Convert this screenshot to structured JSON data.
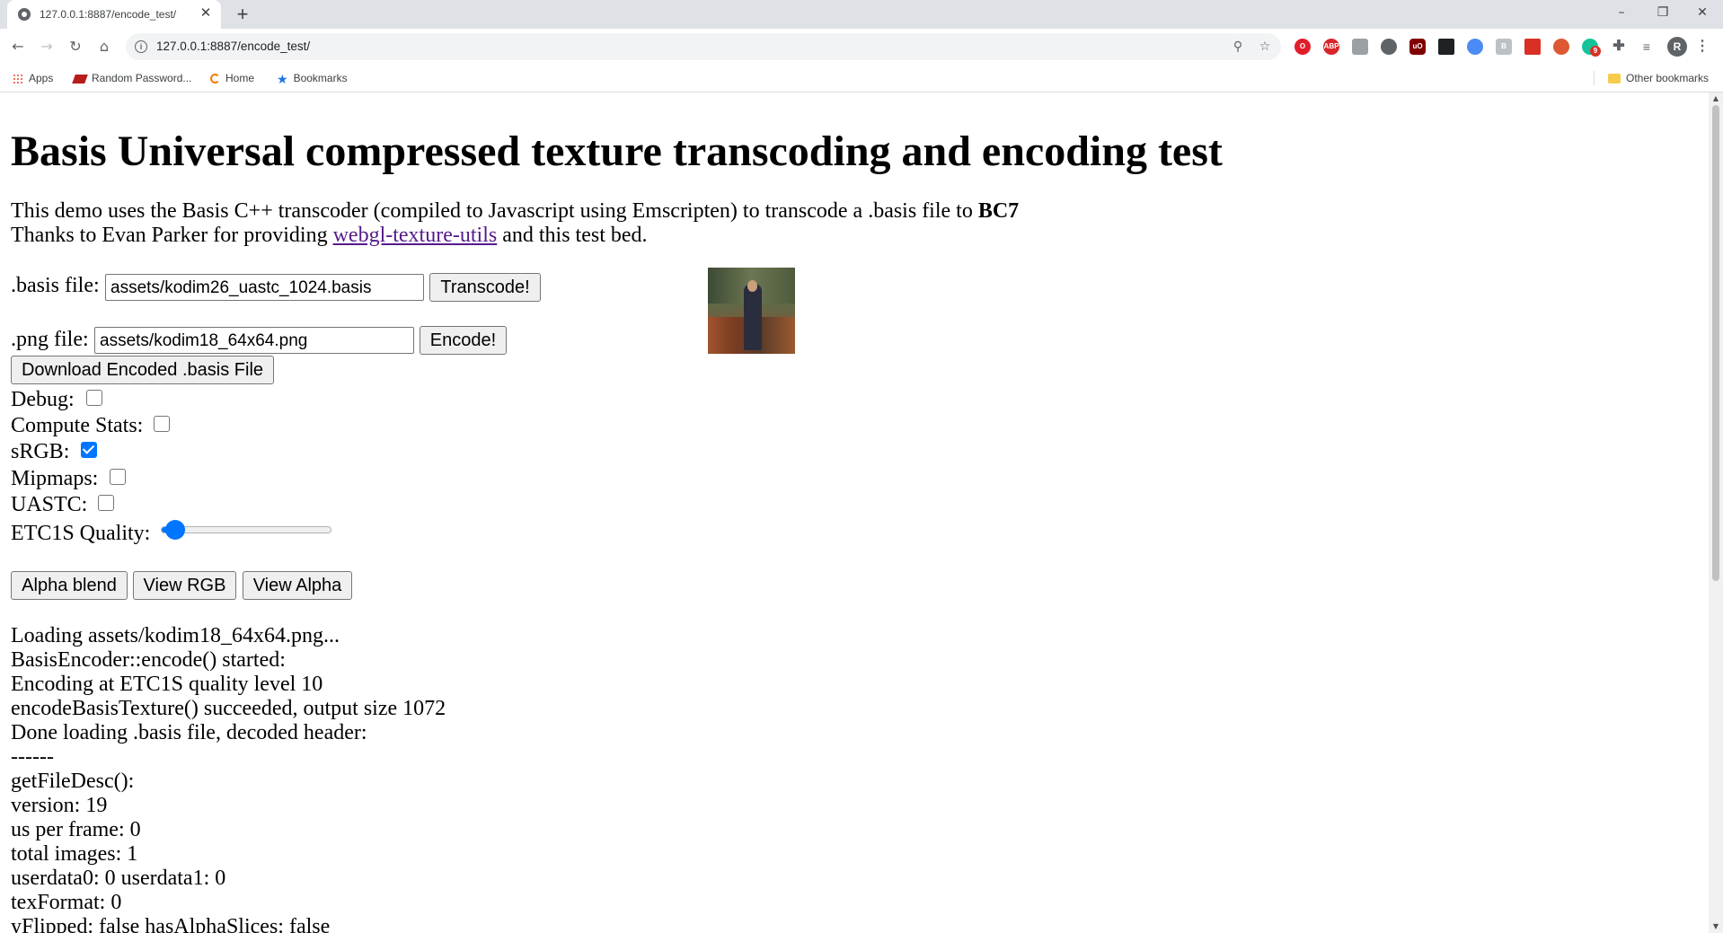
{
  "browser": {
    "tab_title": "127.0.0.1:8887/encode_test/",
    "tab_close": "✕",
    "new_tab": "+",
    "url": "127.0.0.1:8887/encode_test/",
    "window_controls": {
      "minimize": "–",
      "restore": "❐",
      "close": "✕"
    },
    "extensions": [
      "opera-icon",
      "adblock-icon",
      "extension-icon",
      "circle-icon",
      "ublock-icon",
      "stack-icon",
      "edge-icon",
      "b-icon",
      "pdf-icon",
      "duckduckgo-icon",
      "grammarly-icon",
      "puzzle-icon",
      "playlist-icon",
      "avatar"
    ],
    "extension_labels": {
      "adblock": "ABP",
      "ublock": "uO",
      "grammarly_badge": "9",
      "avatar": "R"
    },
    "bookmarks": [
      {
        "label": "Apps"
      },
      {
        "label": "Random Password..."
      },
      {
        "label": "Home"
      },
      {
        "label": "Bookmarks"
      }
    ],
    "other_bookmarks": "Other bookmarks",
    "accent_color": "#0075ff"
  },
  "page": {
    "title": "Basis Universal compressed texture transcoding and encoding test",
    "intro_line1_prefix": "This demo uses the Basis C++ transcoder (compiled to Javascript using Emscripten) to transcode a .basis file to ",
    "intro_line1_format": "BC7",
    "intro_line2_prefix": "Thanks to Evan Parker for providing ",
    "intro_link": "webgl-texture-utils",
    "intro_line2_suffix": " and this test bed.",
    "basis_label": ".basis file:",
    "basis_value": "assets/kodim26_uastc_1024.basis",
    "transcode_button": "Transcode!",
    "png_label": ".png file:",
    "png_value": "assets/kodim18_64x64.png",
    "encode_button": "Encode!",
    "download_button": "Download Encoded .basis File",
    "options": [
      {
        "label": "Debug:",
        "checked": false
      },
      {
        "label": "Compute Stats:",
        "checked": false
      },
      {
        "label": "sRGB:",
        "checked": true
      },
      {
        "label": "Mipmaps:",
        "checked": false
      },
      {
        "label": "UASTC:",
        "checked": false
      }
    ],
    "quality_label": "ETC1S Quality:",
    "quality_value": 0.03,
    "view_buttons": [
      "Alpha blend",
      "View RGB",
      "View Alpha"
    ],
    "log": [
      "Loading assets/kodim18_64x64.png...",
      "BasisEncoder::encode() started:",
      "Encoding at ETC1S quality level 10",
      "encodeBasisTexture() succeeded, output size 1072",
      "Done loading .basis file, decoded header:",
      "------",
      "getFileDesc():",
      "version: 19",
      "us per frame: 0",
      "total images: 1",
      "userdata0: 0 userdata1: 0",
      "texFormat: 0",
      "yFlipped: false hasAlphaSlices: false"
    ]
  }
}
